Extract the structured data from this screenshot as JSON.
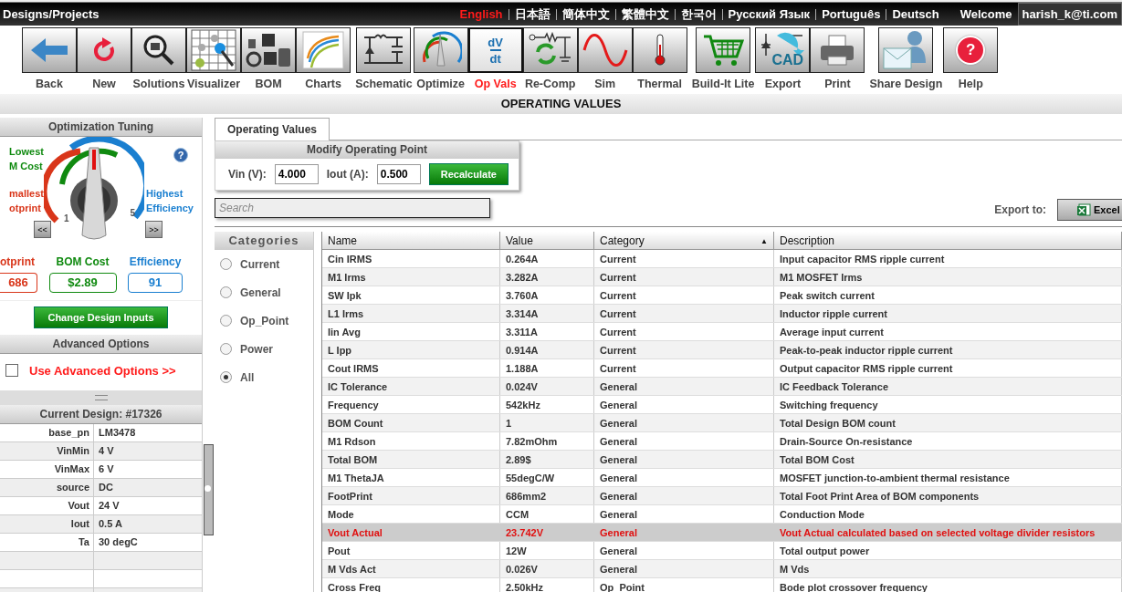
{
  "top_bar": {
    "title": "Designs/Projects",
    "languages": [
      {
        "label": "English",
        "selected": true
      },
      {
        "label": "日本語",
        "selected": false
      },
      {
        "label": "簡体中文",
        "selected": false
      },
      {
        "label": "繁體中文",
        "selected": false
      },
      {
        "label": "한국어",
        "selected": false
      },
      {
        "label": "Русский Язык",
        "selected": false
      },
      {
        "label": "Português",
        "selected": false
      },
      {
        "label": "Deutsch",
        "selected": false
      }
    ],
    "welcome": "Welcome",
    "user": "harish_k@ti.com"
  },
  "toolbar": [
    {
      "label": "Back",
      "kind": "back",
      "selected": false
    },
    {
      "label": "New",
      "kind": "new",
      "selected": false
    },
    {
      "label": "Solutions",
      "kind": "solutions",
      "selected": false
    },
    {
      "label": "Visualizer",
      "kind": "visualizer",
      "selected": false
    },
    {
      "label": "BOM",
      "kind": "bom",
      "selected": false
    },
    {
      "label": "Charts",
      "kind": "charts",
      "selected": false
    },
    {
      "label": "Schematic",
      "kind": "schematic",
      "selected": false
    },
    {
      "label": "Optimize",
      "kind": "optimize",
      "selected": false
    },
    {
      "label": "Op Vals",
      "kind": "opvals",
      "icon_text": [
        "dV",
        "dt"
      ],
      "selected": true
    },
    {
      "label": "Re-Comp",
      "kind": "recomp",
      "selected": false
    },
    {
      "label": "Sim",
      "kind": "sim",
      "selected": false
    },
    {
      "label": "Thermal",
      "kind": "thermal",
      "selected": false
    },
    {
      "label": "Build-It Lite",
      "kind": "cart",
      "selected": false
    },
    {
      "label": "Export",
      "kind": "export",
      "icon_text": [
        "CAD"
      ],
      "selected": false
    },
    {
      "label": "Print",
      "kind": "print",
      "selected": false
    },
    {
      "label": "Share Design",
      "kind": "share",
      "selected": false
    },
    {
      "label": "Help",
      "kind": "help",
      "icon_text": [
        "?"
      ],
      "selected": false
    }
  ],
  "page_title": "OPERATING VALUES",
  "optimization": {
    "title": "Optimization Tuning",
    "labels": {
      "cost": [
        "Lowest",
        "M Cost"
      ],
      "footprint": [
        "mallest",
        "otprint"
      ],
      "efficiency": [
        "Highest",
        "Efficiency"
      ]
    },
    "knob": {
      "level": 0.5,
      "min": "1",
      "max": "5"
    },
    "help": "?",
    "prev": "<<",
    "next": ">>",
    "metrics": [
      {
        "label": "otprint",
        "value": "686",
        "color": "#d9361a"
      },
      {
        "label": "BOM Cost",
        "value": "$2.89",
        "color": "#108a10"
      },
      {
        "label": "Efficiency",
        "value": "91",
        "color": "#1a7fd0"
      }
    ],
    "change_button": "Change Design Inputs"
  },
  "advanced": {
    "title": "Advanced Options",
    "checked": false,
    "label": "Use Advanced Options >>"
  },
  "current_design": {
    "title": "Current Design: #17326",
    "rows": [
      {
        "key": "base_pn",
        "value": "LM3478"
      },
      {
        "key": "VinMin",
        "value": "4 V"
      },
      {
        "key": "VinMax",
        "value": "6 V"
      },
      {
        "key": "source",
        "value": "DC"
      },
      {
        "key": "Vout",
        "value": "24 V"
      },
      {
        "key": "Iout",
        "value": "0.5 A"
      },
      {
        "key": "Ta",
        "value": "30 degC"
      }
    ]
  },
  "tabs": [
    {
      "label": "Operating Values",
      "selected": true
    }
  ],
  "operating_point": {
    "title": "Modify Operating Point",
    "vin_label": "Vin (V):",
    "vin": "4.000",
    "iout_label": "Iout (A):",
    "iout": "0.500",
    "button": "Recalculate"
  },
  "search": {
    "placeholder": "Search"
  },
  "export": {
    "label": "Export to:",
    "button": "Excel"
  },
  "categories": {
    "title": "Categories",
    "items": [
      {
        "label": "Current",
        "selected": false
      },
      {
        "label": "General",
        "selected": false
      },
      {
        "label": "Op_Point",
        "selected": false
      },
      {
        "label": "Power",
        "selected": false
      },
      {
        "label": "All",
        "selected": true
      }
    ]
  },
  "table": {
    "columns": [
      {
        "label": "Name"
      },
      {
        "label": "Value"
      },
      {
        "label": "Category",
        "sort_mark": "▲"
      },
      {
        "label": "Description"
      }
    ],
    "rows": [
      {
        "cells": [
          "Cin IRMS",
          "0.264A",
          "Current",
          "Input capacitor RMS ripple current"
        ],
        "highlight": false
      },
      {
        "cells": [
          "M1 Irms",
          "3.282A",
          "Current",
          "M1 MOSFET Irms"
        ],
        "highlight": false
      },
      {
        "cells": [
          "SW Ipk",
          "3.760A",
          "Current",
          "Peak switch current"
        ],
        "highlight": false
      },
      {
        "cells": [
          "L1 Irms",
          "3.314A",
          "Current",
          "Inductor ripple current"
        ],
        "highlight": false
      },
      {
        "cells": [
          "Iin Avg",
          "3.311A",
          "Current",
          "Average input current"
        ],
        "highlight": false
      },
      {
        "cells": [
          "L Ipp",
          "0.914A",
          "Current",
          "Peak-to-peak inductor ripple current"
        ],
        "highlight": false
      },
      {
        "cells": [
          "Cout IRMS",
          "1.188A",
          "Current",
          "Output capacitor RMS ripple current"
        ],
        "highlight": false
      },
      {
        "cells": [
          "IC Tolerance",
          "0.024V",
          "General",
          "IC Feedback Tolerance"
        ],
        "highlight": false
      },
      {
        "cells": [
          "Frequency",
          "542kHz",
          "General",
          "Switching frequency"
        ],
        "highlight": false
      },
      {
        "cells": [
          "BOM Count",
          "1",
          "General",
          "Total Design BOM count"
        ],
        "highlight": false
      },
      {
        "cells": [
          "M1 Rdson",
          "7.82mOhm",
          "General",
          "Drain-Source On-resistance"
        ],
        "highlight": false
      },
      {
        "cells": [
          "Total BOM",
          "2.89$",
          "General",
          "Total BOM Cost"
        ],
        "highlight": false
      },
      {
        "cells": [
          "M1 ThetaJA",
          "55degC/W",
          "General",
          "MOSFET junction-to-ambient thermal resistance"
        ],
        "highlight": false
      },
      {
        "cells": [
          "FootPrint",
          "686mm2",
          "General",
          "Total Foot Print Area of BOM components"
        ],
        "highlight": false
      },
      {
        "cells": [
          "Mode",
          "CCM",
          "General",
          "Conduction Mode"
        ],
        "highlight": false
      },
      {
        "cells": [
          "Vout Actual",
          "23.742V",
          "General",
          "Vout Actual calculated based on selected voltage divider resistors"
        ],
        "highlight": true
      },
      {
        "cells": [
          "Pout",
          "12W",
          "General",
          "Total output power"
        ],
        "highlight": false
      },
      {
        "cells": [
          "M Vds Act",
          "0.026V",
          "General",
          "M Vds"
        ],
        "highlight": false
      },
      {
        "cells": [
          "Cross Freq",
          "2.50kHz",
          "Op_Point",
          "Bode plot crossover frequency"
        ],
        "highlight": false
      }
    ]
  }
}
